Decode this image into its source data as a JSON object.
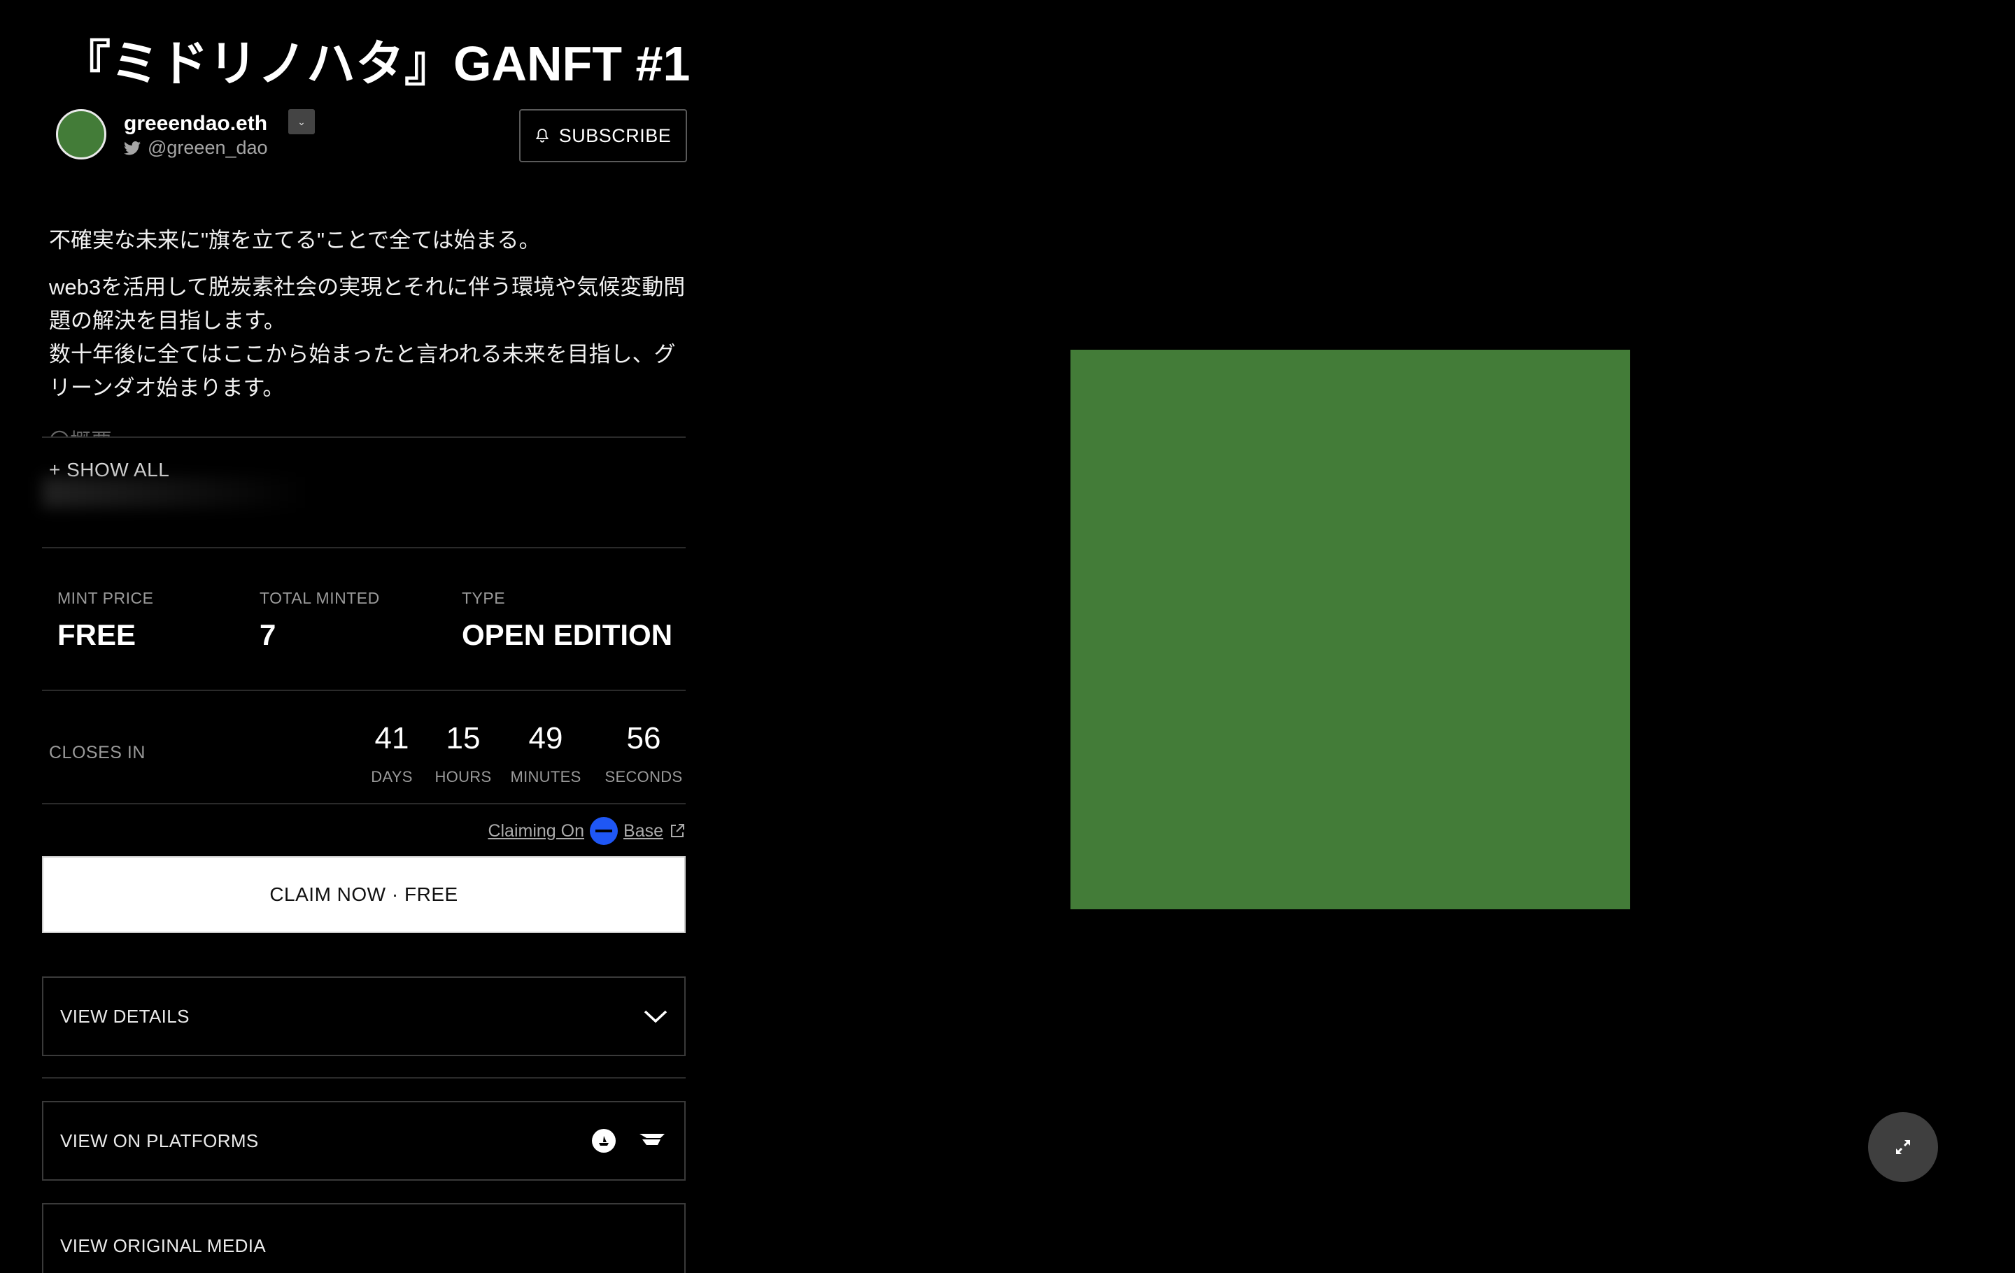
{
  "title": "『ミドリノハタ』GANFT #1",
  "artist": {
    "name": "greeendao.eth",
    "handle": "@greeen_dao",
    "avatar_color": "#437c38"
  },
  "subscribe_label": "SUBSCRIBE",
  "description": {
    "paragraphs": [
      "不確実な未来に\"旗を立てる\"ことで全ては始まる。",
      "web3を活用して脱炭素社会の実現とそれに伴う環境や気候変動問題の解決を目指します。\n数十年後に全てはここから始まったと言われる未来を目指し、グリーンダオ始まります。"
    ],
    "faded_line": "〇概要"
  },
  "show_all_label": "+ SHOW ALL",
  "stats": [
    {
      "label": "MINT PRICE",
      "value": "FREE"
    },
    {
      "label": "TOTAL MINTED",
      "value": "7"
    },
    {
      "label": "TYPE",
      "value": "OPEN EDITION"
    }
  ],
  "countdown": {
    "label": "CLOSES IN",
    "units": [
      {
        "value": "41",
        "unit": "DAYS"
      },
      {
        "value": "15",
        "unit": "HOURS"
      },
      {
        "value": "49",
        "unit": "MINUTES"
      },
      {
        "value": "56",
        "unit": "SECONDS"
      }
    ]
  },
  "claiming": {
    "prefix": "Claiming On",
    "chain": "Base",
    "chain_color": "#1f57f5"
  },
  "claim_button_label": "CLAIM NOW · FREE",
  "panels": {
    "details": "VIEW DETAILS",
    "platforms": "VIEW ON PLATFORMS",
    "original_media": "VIEW ORIGINAL MEDIA"
  },
  "artwork_color": "#437c38",
  "icons": {
    "subscribe": "bell-icon",
    "handle": "twitter-icon",
    "external": "external-link-icon",
    "details": "chevron-down-icon",
    "platform_1": "opensea-icon",
    "platform_2": "rarible-icon",
    "expand": "collapse-arrows-icon"
  }
}
